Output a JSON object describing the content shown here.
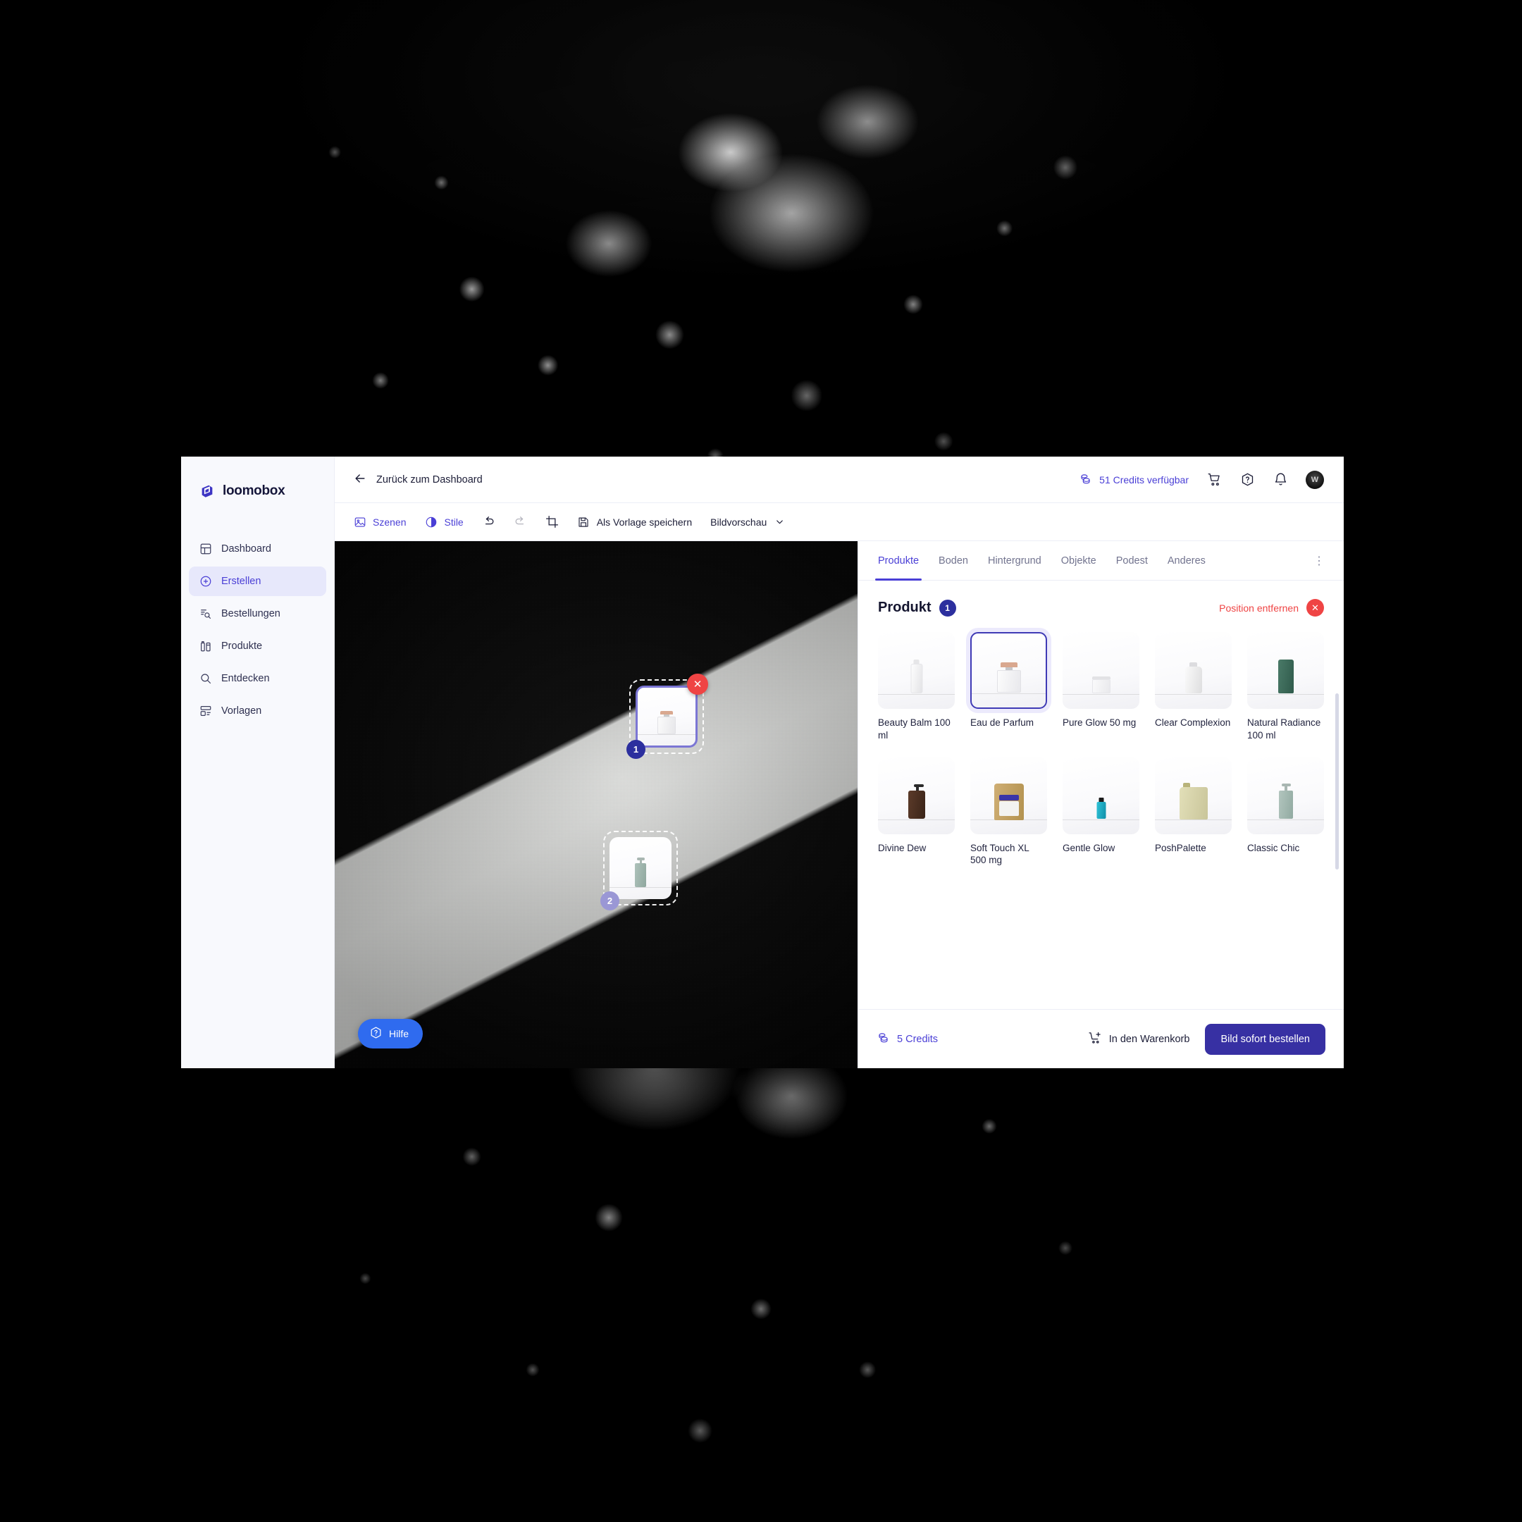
{
  "brand": {
    "name": "loomobox",
    "logo_icon": "cube-logo-icon"
  },
  "sidebar": {
    "items": [
      {
        "label": "Dashboard",
        "icon": "layout-dashboard-icon",
        "active": false
      },
      {
        "label": "Erstellen",
        "icon": "plus-circle-icon",
        "active": true
      },
      {
        "label": "Bestellungen",
        "icon": "list-search-icon",
        "active": false
      },
      {
        "label": "Produkte",
        "icon": "bottles-icon",
        "active": false
      },
      {
        "label": "Entdecken",
        "icon": "search-icon",
        "active": false
      },
      {
        "label": "Vorlagen",
        "icon": "templates-icon",
        "active": false
      }
    ]
  },
  "topbar": {
    "back_label": "Zurück zum Dashboard",
    "back_icon": "arrow-left-icon",
    "credits_label": "51 Credits verfügbar",
    "credits_icon": "coins-icon",
    "cart_icon": "shopping-cart-icon",
    "help_icon": "question-hexagon-icon",
    "notifications_icon": "bell-icon",
    "avatar_initial": "W"
  },
  "toolbar": {
    "scenes_label": "Szenen",
    "scenes_icon": "image-icon",
    "styles_label": "Stile",
    "styles_icon": "contrast-circle-icon",
    "undo_icon": "undo-arrow-icon",
    "redo_icon": "redo-arrow-icon",
    "crop_icon": "crop-icon",
    "save_template_label": "Als Vorlage speichern",
    "save_template_icon": "floppy-disk-icon",
    "preview_label": "Bildvorschau",
    "preview_chevron_icon": "chevron-down-icon"
  },
  "canvas": {
    "help_label": "Hilfe",
    "help_icon": "question-hexagon-icon",
    "placements": [
      {
        "number": "1",
        "product": "Eau de Parfum",
        "selected": true,
        "close_icon": "close-x-icon"
      },
      {
        "number": "2",
        "product": "Classic Chic",
        "selected": false
      }
    ]
  },
  "panel": {
    "tabs": [
      {
        "label": "Produkte",
        "active": true
      },
      {
        "label": "Boden",
        "active": false
      },
      {
        "label": "Hintergrund",
        "active": false
      },
      {
        "label": "Objekte",
        "active": false
      },
      {
        "label": "Podest",
        "active": false
      },
      {
        "label": "Anderes",
        "active": false
      }
    ],
    "kebab_icon": "more-vertical-icon",
    "title": "Produkt",
    "title_badge": "1",
    "remove_label": "Position entfernen",
    "remove_icon": "close-x-icon",
    "products": [
      {
        "label": "Beauty Balm 100 ml",
        "selected": false,
        "kind": "spray-bottle",
        "color": "#e9e9ea"
      },
      {
        "label": "Eau de Parfum",
        "selected": true,
        "kind": "perfume-flask",
        "color": "#f2efef"
      },
      {
        "label": "Pure Glow 50 mg",
        "selected": false,
        "kind": "small-jar",
        "color": "#ededef"
      },
      {
        "label": "Clear Complexion",
        "selected": false,
        "kind": "round-bottle",
        "color": "#e4e4e5"
      },
      {
        "label": "Natural Radiance 100 ml",
        "selected": false,
        "kind": "tube",
        "color": "#3f6b5c"
      },
      {
        "label": "Divine Dew",
        "selected": false,
        "kind": "pump-bottle",
        "color": "#4a2f22"
      },
      {
        "label": "Soft Touch XL 500 mg",
        "selected": false,
        "kind": "pouch",
        "color": "#c5a468"
      },
      {
        "label": "Gentle Glow",
        "selected": false,
        "kind": "mini-bottle",
        "color": "#19b6cf"
      },
      {
        "label": "PoshPalette",
        "selected": false,
        "kind": "refill-pouch",
        "color": "#d9d6ad"
      },
      {
        "label": "Classic Chic",
        "selected": false,
        "kind": "pump-tall",
        "color": "#9cb7ad"
      }
    ],
    "footer": {
      "credits_label": "5 Credits",
      "credits_icon": "coins-icon",
      "cart_label": "In den Warenkorb",
      "cart_icon": "cart-plus-icon",
      "order_label": "Bild sofort bestellen"
    }
  },
  "colors": {
    "accent": "#4a3fd6",
    "accent_dark": "#3730a3",
    "danger": "#ef4444",
    "help_blue": "#2f6bef",
    "badge": "#2c2f9e"
  }
}
